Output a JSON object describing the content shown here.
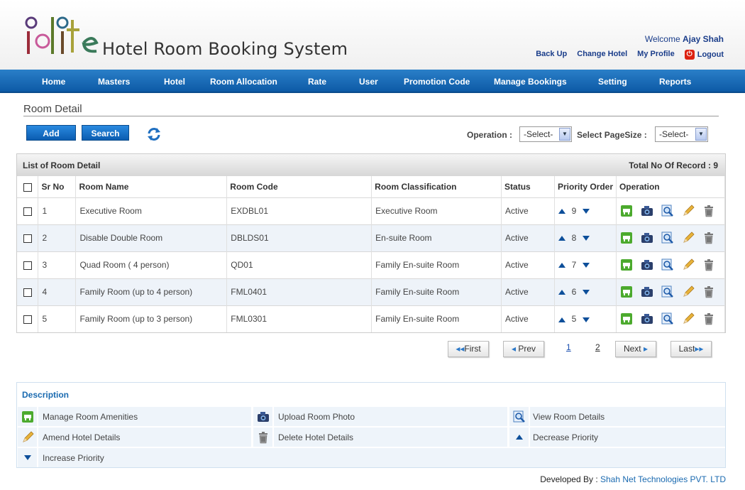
{
  "header": {
    "title": "Hotel Room Booking System",
    "welcome_prefix": "Welcome",
    "user_name": "Ajay Shah",
    "links": [
      "Back Up",
      "Change Hotel",
      "My Profile",
      "Logout"
    ]
  },
  "nav": [
    "Home",
    "Masters",
    "Hotel",
    "Room Allocation",
    "Rate",
    "User",
    "Promotion Code",
    "Manage Bookings",
    "Setting",
    "Reports"
  ],
  "page": {
    "title": "Room Detail",
    "add_label": "Add",
    "search_label": "Search",
    "operation_label": "Operation :",
    "operation_value": "-Select-",
    "pagesize_label": "Select PageSize :",
    "pagesize_value": "-Select-"
  },
  "grid": {
    "caption": "List of Room Detail",
    "total": "Total No Of Record : 9",
    "columns": [
      "Sr No",
      "Room Name",
      "Room Code",
      "Room Classification",
      "Status",
      "Priority Order",
      "Operation"
    ],
    "rows": [
      {
        "sr": "1",
        "name": "Executive Room",
        "code": "EXDBL01",
        "class": "Executive Room",
        "status": "Active",
        "priority": "9"
      },
      {
        "sr": "2",
        "name": "Disable Double Room",
        "code": "DBLDS01",
        "class": "En-suite Room",
        "status": "Active",
        "priority": "8"
      },
      {
        "sr": "3",
        "name": "Quad Room ( 4 person)",
        "code": "QD01",
        "class": "Family En-suite Room",
        "status": "Active",
        "priority": "7"
      },
      {
        "sr": "4",
        "name": "Family Room (up to 4 person)",
        "code": "FML0401",
        "class": "Family En-suite Room",
        "status": "Active",
        "priority": "6"
      },
      {
        "sr": "5",
        "name": "Family Room (up to 3 person)",
        "code": "FML0301",
        "class": "Family En-suite Room",
        "status": "Active",
        "priority": "5"
      }
    ]
  },
  "pager": {
    "first": "First",
    "prev": "Prev",
    "pages": [
      "1",
      "2"
    ],
    "next": "Next",
    "last": "Last"
  },
  "description": {
    "title": "Description",
    "items": [
      "Manage Room Amenities",
      "Upload Room Photo",
      "View Room Details",
      "Amend Hotel Details",
      "Delete Hotel Details",
      "Decrease Priority",
      "Increase Priority"
    ]
  },
  "footer": {
    "prefix": "Developed By :",
    "company": "Shah Net Technologies PVT. LTD"
  },
  "colors": {
    "nav": "#0d5aa6",
    "accent": "#1a6ab0"
  }
}
